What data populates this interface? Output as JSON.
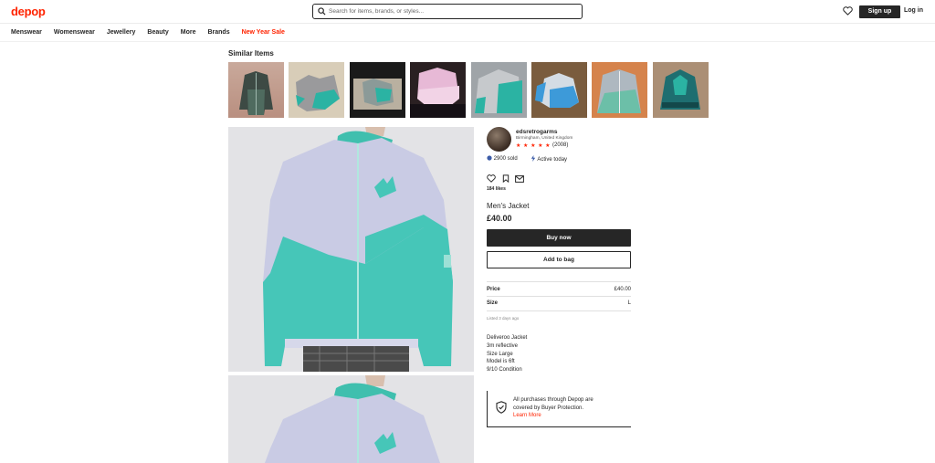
{
  "brand": {
    "logo": "depop",
    "accent": "#ff2300"
  },
  "header": {
    "search_placeholder": "Search for items, brands, or styles...",
    "search_icon": "search-icon",
    "heart_icon": "heart-icon",
    "signup_label": "Sign up",
    "login_label": "Log in"
  },
  "nav": {
    "items": [
      "Menswear",
      "Womenswear",
      "Jewellery",
      "Beauty",
      "More",
      "Brands",
      "New Year Sale"
    ]
  },
  "similar": {
    "title": "Similar Items",
    "thumbs": [
      "thumb-1",
      "thumb-2",
      "thumb-3",
      "thumb-4",
      "thumb-5",
      "thumb-6",
      "thumb-7",
      "thumb-8"
    ]
  },
  "seller": {
    "name": "edsretrogarms",
    "location": "Birmingham, United Kingdom",
    "stars": "★ ★ ★ ★ ★",
    "reviews": "(2008)",
    "sold": "2900 sold",
    "active": "Active today",
    "likes": "184 likes"
  },
  "product": {
    "title": "Men's Jacket",
    "price": "£40.00",
    "buy_label": "Buy now",
    "bag_label": "Add to bag",
    "details": [
      {
        "label": "Price",
        "value": "£40.00"
      },
      {
        "label": "Size",
        "value": "L"
      }
    ],
    "listed": "Listed 3 days ago",
    "description": [
      "Deliveroo Jacket",
      "3m reflective",
      "Size Large",
      "Model is 6ft",
      "9/10 Condition"
    ]
  },
  "protection": {
    "line1": "All purchases through Depop are",
    "line2": "covered by Buyer Protection.",
    "link": "Learn More"
  }
}
